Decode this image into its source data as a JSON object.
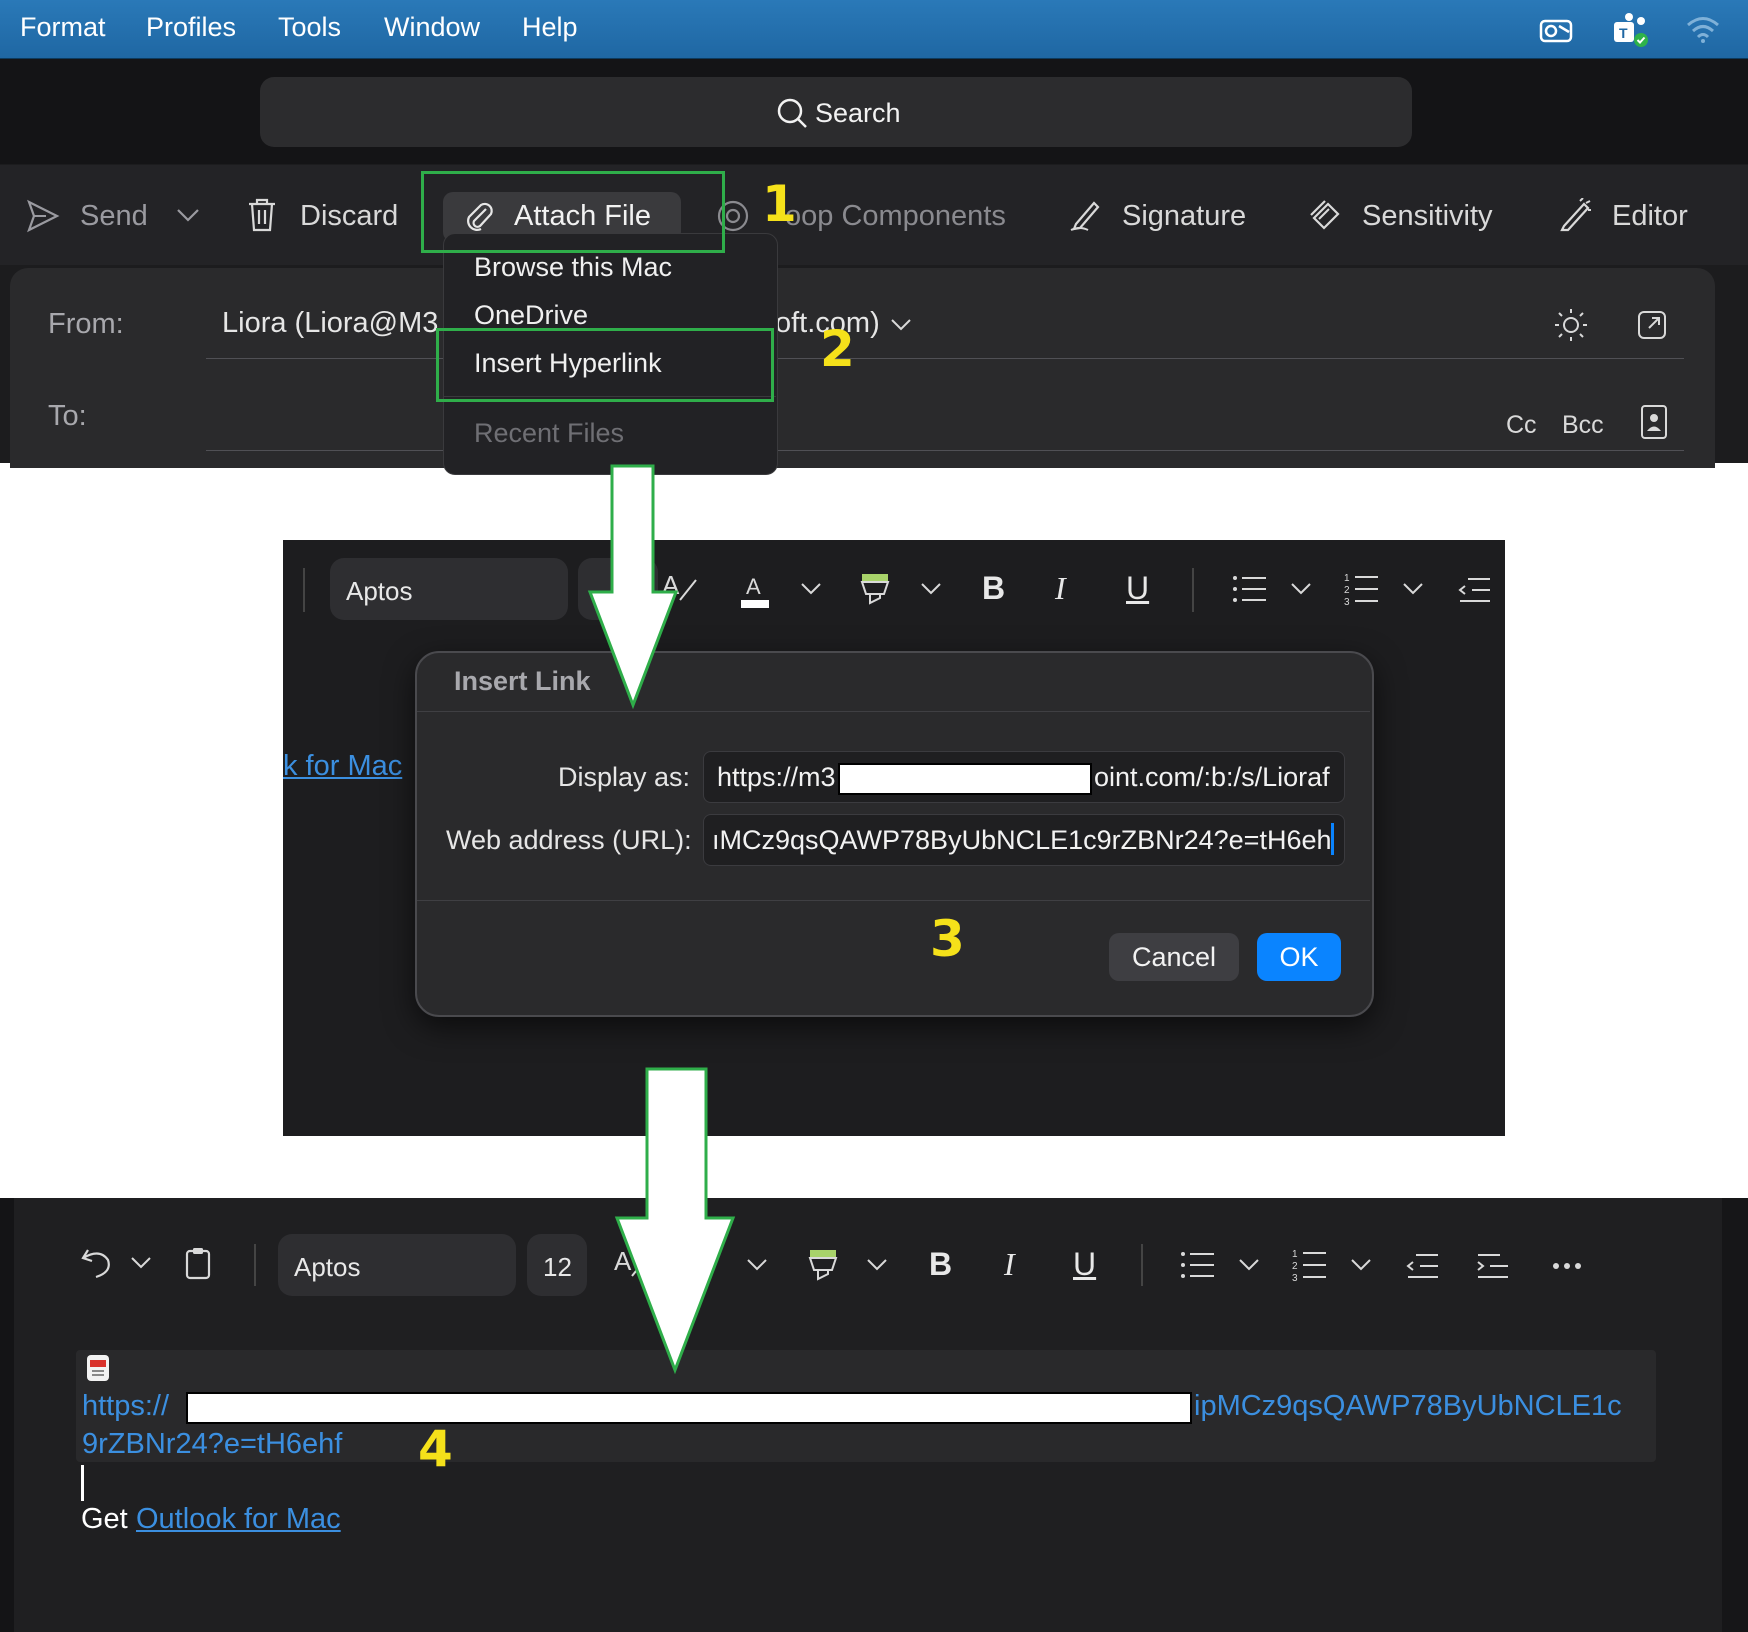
{
  "menubar": {
    "items": [
      "Format",
      "Profiles",
      "Tools",
      "Window",
      "Help"
    ]
  },
  "search": {
    "label": "Search"
  },
  "toolbar": {
    "send": "Send",
    "discard": "Discard",
    "attach_file": "Attach File",
    "loop_components": "oop Components",
    "signature": "Signature",
    "sensitivity": "Sensitivity",
    "editor": "Editor"
  },
  "compose": {
    "from_label": "From:",
    "from_value_left": "Liora (Liora@M3",
    "from_value_right": "oft.com)",
    "to_label": "To:",
    "cc": "Cc",
    "bcc": "Bcc"
  },
  "attach_menu": {
    "items": [
      "Browse this Mac",
      "OneDrive",
      "Insert Hyperlink"
    ],
    "section": "Recent Files"
  },
  "annotations": [
    "1",
    "2",
    "3",
    "4"
  ],
  "format_toolbar": {
    "font": "Aptos",
    "size": "12"
  },
  "background_link_fragment": "k for Mac",
  "insert_link_dialog": {
    "title": "Insert Link",
    "display_as_label": "Display as:",
    "display_as_prefix": "https://m3",
    "display_as_suffix": "oint.com/:b:/s/Lioraf",
    "url_label": "Web address (URL):",
    "url_value": "ıMCz9qsQAWP78ByUbNCLE1c9rZBNr24?e=tH6ehf",
    "cancel": "Cancel",
    "ok": "OK"
  },
  "result": {
    "link_prefix": "https://",
    "link_suffix_line1": "ipMCz9qsQAWP78ByUbNCLE1c",
    "link_line2": "9rZBNr24?e=tH6ehf",
    "get_text": "Get ",
    "outlook_link": "Outlook for Mac"
  },
  "colors": {
    "annotation_box": "#2fae4a",
    "annotation_number": "#f5e11a",
    "link": "#3b8fe0",
    "ok_button": "#0a84ff",
    "menubar": "#1f67a3"
  },
  "icons": [
    "send-icon",
    "trash-icon",
    "paperclip-icon",
    "loop-icon",
    "signature-icon",
    "sensitivity-icon",
    "editor-icon",
    "search-icon",
    "theme-icon",
    "popout-icon",
    "contact-icon",
    "undo-icon",
    "clipboard-icon",
    "font-color-icon",
    "highlighter-icon",
    "bold-icon",
    "italic-icon",
    "underline-icon",
    "bullets-icon",
    "numbering-icon",
    "outdent-icon",
    "indent-icon",
    "more-icon",
    "pdf-icon",
    "wifi-icon",
    "teams-icon",
    "outlook-icon"
  ]
}
